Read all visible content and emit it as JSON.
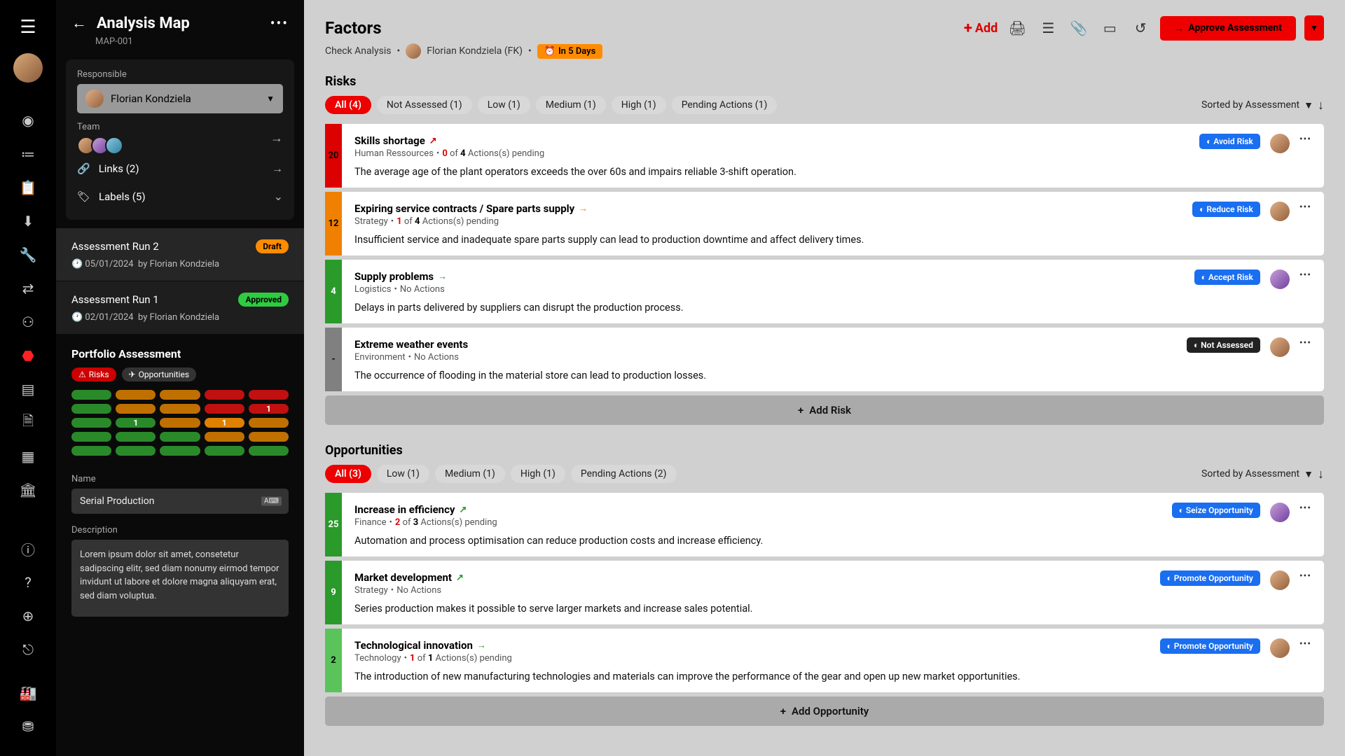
{
  "rail": {
    "icons": [
      "dashboard",
      "list",
      "clipboard",
      "download",
      "wrench",
      "network",
      "org",
      "shield",
      "doc",
      "file",
      "table",
      "library",
      "info",
      "help",
      "globe",
      "logout",
      "factory",
      "database"
    ]
  },
  "sidebar": {
    "title": "Analysis Map",
    "code": "MAP-001",
    "responsible_label": "Responsible",
    "responsible": "Florian Kondziela",
    "team_label": "Team",
    "links_label": "Links (2)",
    "labels_label": "Labels (5)",
    "runs": [
      {
        "name": "Assessment Run 2",
        "status": "Draft",
        "date": "05/01/2024",
        "by": "Florian Kondziela",
        "selected": true
      },
      {
        "name": "Assessment Run 1",
        "status": "Approved",
        "date": "02/01/2024",
        "by": "Florian Kondziela",
        "selected": false
      }
    ],
    "portfolio": {
      "title": "Portfolio Assessment",
      "risks": "Risks",
      "opps": "Opportunities",
      "cells": [
        [
          "g",
          "o",
          "o",
          "r",
          "r"
        ],
        [
          "g",
          "o",
          "o",
          "r",
          "r1"
        ],
        [
          "g",
          "g1",
          "o",
          "og1",
          "o"
        ],
        [
          "g",
          "g",
          "g",
          "o",
          "o"
        ],
        [
          "g",
          "g",
          "g",
          "g",
          "g"
        ]
      ]
    },
    "name_label": "Name",
    "name_value": "Serial Production",
    "desc_label": "Description",
    "desc_value": "Lorem ipsum dolor sit amet, consetetur sadipscing elitr, sed diam nonumy eirmod tempor invidunt ut labore et dolore magna aliquyam erat, sed diam voluptua."
  },
  "main": {
    "title": "Factors",
    "add": "Add",
    "approve": "Approve Assessment",
    "crumb1": "Check Analysis",
    "crumb2": "Florian Kondziela (FK)",
    "due": "In 5 Days",
    "sort": "Sorted by Assessment",
    "risks": {
      "title": "Risks",
      "filters": [
        "All (4)",
        "Not Assessed (1)",
        "Low (1)",
        "Medium (1)",
        "High (1)",
        "Pending Actions (1)"
      ],
      "add": "Add Risk",
      "items": [
        {
          "score": 20,
          "color": "red",
          "title": "Skills shortage",
          "trend": "up",
          "trend_color": "#d00",
          "cat": "Human Ressources",
          "actions_a": 0,
          "actions_b": 4,
          "has_actions": true,
          "desc": "The average age of the plant operators exceeds the over 60s and impairs reliable 3-shift operation.",
          "action": "Avoid Risk",
          "badge": "blue",
          "ava": "c1"
        },
        {
          "score": 12,
          "color": "orange",
          "title": "Expiring service contracts / Spare parts supply",
          "trend": "right",
          "trend_color": "#f08000",
          "cat": "Strategy",
          "actions_a": 1,
          "actions_b": 4,
          "has_actions": true,
          "desc": "Insufficient service and inadequate spare parts supply can lead to production downtime and affect delivery times.",
          "action": "Reduce Risk",
          "badge": "blue",
          "ava": "c1"
        },
        {
          "score": 4,
          "color": "green",
          "title": "Supply problems",
          "trend": "right",
          "trend_color": "#2a9a2a",
          "cat": "Logistics",
          "no_actions": "No Actions",
          "desc": "Delays in parts delivered by suppliers can disrupt the production process.",
          "action": "Accept Risk",
          "badge": "blue",
          "ava": "c2"
        },
        {
          "score": "-",
          "color": "grey",
          "title": "Extreme weather events",
          "trend": "",
          "cat": "Environment",
          "no_actions": "No Actions",
          "desc": "The occurrence of flooding in the material store can lead to production losses.",
          "action": "Not Assessed",
          "badge": "dark",
          "ava": "c1"
        }
      ]
    },
    "opps": {
      "title": "Opportunities",
      "filters": [
        "All (3)",
        "Low (1)",
        "Medium (1)",
        "High (1)",
        "Pending Actions (2)"
      ],
      "add": "Add Opportunity",
      "items": [
        {
          "score": 25,
          "color": "green",
          "title": "Increase in efficiency",
          "trend": "up",
          "trend_color": "#2a9a2a",
          "cat": "Finance",
          "actions_a": 2,
          "actions_b": 3,
          "has_actions": true,
          "desc": "Automation and process optimisation can reduce production costs and increase efficiency.",
          "action": "Seize Opportunity",
          "badge": "blue",
          "ava": "c2"
        },
        {
          "score": 9,
          "color": "green",
          "title": "Market development",
          "trend": "up",
          "trend_color": "#2a9a2a",
          "cat": "Strategy",
          "no_actions": "No Actions",
          "desc": "Series production makes it possible to serve larger markets and increase sales potential.",
          "action": "Promote Opportunity",
          "badge": "blue",
          "ava": "c1"
        },
        {
          "score": 2,
          "color": "lgreen",
          "title": "Technological innovation",
          "trend": "right",
          "trend_color": "#2a9a2a",
          "cat": "Technology",
          "actions_a": 1,
          "actions_b": 1,
          "has_actions": true,
          "desc": "The introduction of new manufacturing technologies and materials can improve the performance of the gear and open up new market opportunities.",
          "action": "Promote Opportunity",
          "badge": "blue",
          "ava": "c1"
        }
      ]
    }
  }
}
